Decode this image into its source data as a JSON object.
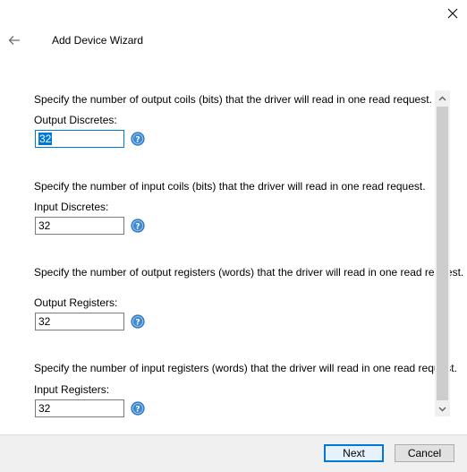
{
  "window": {
    "title": "Add Device Wizard"
  },
  "sections": [
    {
      "description": "Specify the number of output coils (bits) that the driver will read in one read request.",
      "label": "Output Discretes:",
      "value": "32"
    },
    {
      "description": "Specify the number of input coils (bits) that the driver will read in one read request.",
      "label": "Input Discretes:",
      "value": "32"
    },
    {
      "description": "Specify the number of output registers (words) that the driver will read in one read request.",
      "label": "Output Registers:",
      "value": "32"
    },
    {
      "description": "Specify the number of input registers (words) that the driver will read in one read request.",
      "label": "Input Registers:",
      "value": "32"
    }
  ],
  "footer": {
    "next_label": "Next",
    "cancel_label": "Cancel"
  },
  "icons": {
    "close": "close-icon",
    "back": "back-arrow-icon",
    "help": "help-icon",
    "scroll_up": "chevron-up-icon",
    "scroll_down": "chevron-down-icon"
  },
  "colors": {
    "accent": "#0078d7",
    "help_icon": "#3c8ad6",
    "footer_bg": "#f0f0f0"
  }
}
